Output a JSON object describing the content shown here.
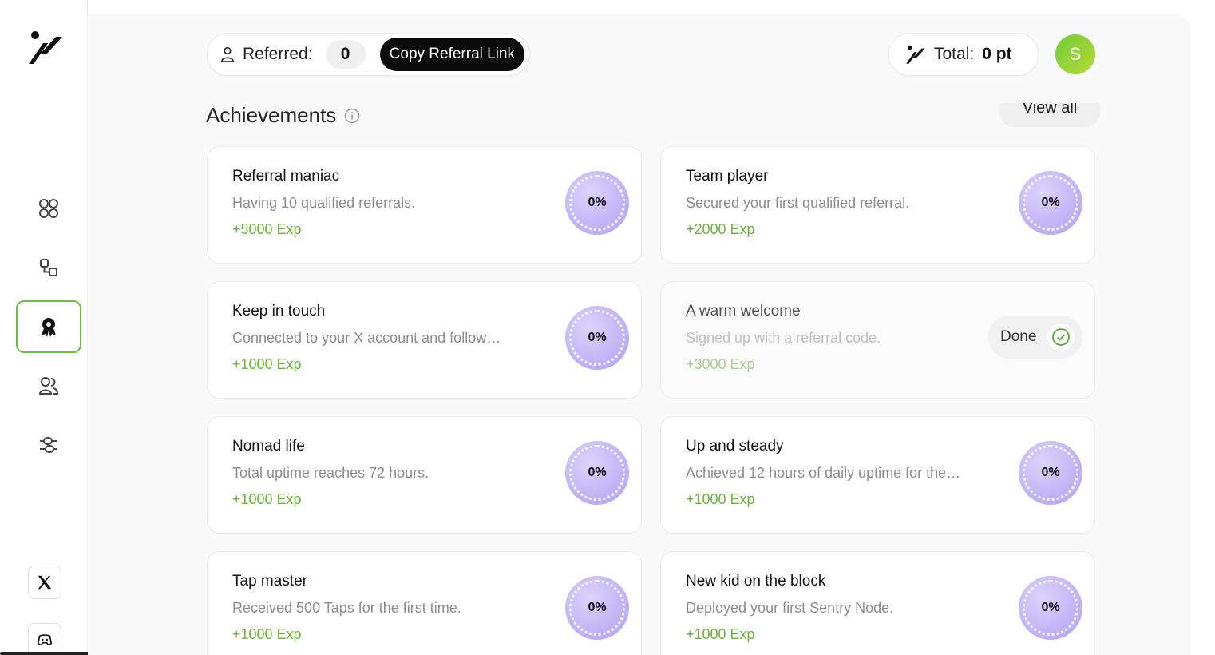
{
  "header": {
    "referred_label": "Referred:",
    "referred_count": "0",
    "copy_button": "Copy Referral Link",
    "total_label": "Total:",
    "total_value": "0 pt",
    "avatar_initial": "S"
  },
  "sidebar": {
    "items": [
      {
        "icon": "grid-icon",
        "active": false
      },
      {
        "icon": "nodes-icon",
        "active": false
      },
      {
        "icon": "achievement-badge-icon",
        "active": true
      },
      {
        "icon": "users-icon",
        "active": false
      },
      {
        "icon": "settings-sliders-icon",
        "active": false
      }
    ],
    "social": [
      "x-icon",
      "discord-icon"
    ]
  },
  "achievements": {
    "title": "Achievements",
    "view_all": "View all",
    "cards": [
      {
        "title": "Referral maniac",
        "desc": "Having 10 qualified referrals.",
        "exp": "+5000 Exp",
        "progress": "0%"
      },
      {
        "title": "Team player",
        "desc": "Secured your first qualified referral.",
        "exp": "+2000 Exp",
        "progress": "0%"
      },
      {
        "title": "Keep in touch",
        "desc": "Connected to your X account and follow…",
        "exp": "+1000 Exp",
        "progress": "0%"
      },
      {
        "title": "A warm welcome",
        "desc": "Signed up with a referral code.",
        "exp": "+3000 Exp",
        "status": "Done"
      },
      {
        "title": "Nomad life",
        "desc": "Total uptime reaches 72 hours.",
        "exp": "+1000 Exp",
        "progress": "0%"
      },
      {
        "title": "Up and steady",
        "desc": "Achieved 12 hours of daily uptime for the…",
        "exp": "+1000 Exp",
        "progress": "0%"
      },
      {
        "title": "Tap master",
        "desc": "Received 500 Taps for the first time.",
        "exp": "+1000 Exp",
        "progress": "0%"
      },
      {
        "title": "New kid on the block",
        "desc": "Deployed your first Sentry Node.",
        "exp": "+1000 Exp",
        "progress": "0%"
      }
    ]
  },
  "colors": {
    "accent_green": "#6ab43b",
    "progress_purple": "#c2b6f6",
    "active_border": "#6bc04a"
  }
}
